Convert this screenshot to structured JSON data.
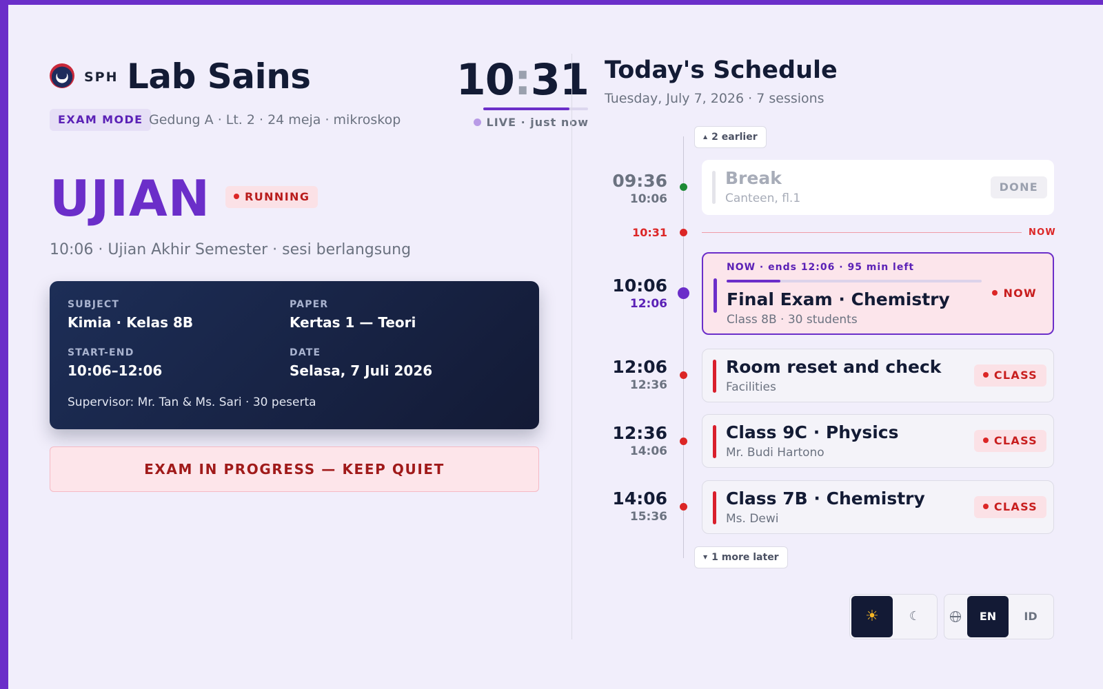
{
  "colors": {
    "accent": "#6b2ec9",
    "danger": "#dc2626",
    "done_green": "#1d8a35",
    "card_dark": "#131a35",
    "background": "#f1eefb"
  },
  "header": {
    "logo_icon": "school-crest-icon",
    "brand": "SPH",
    "room_title": "Lab Sains",
    "mode_badge": "EXAM MODE",
    "room_meta": "Gedung A · Lt. 2 · 24 meja · mikroskop"
  },
  "clock": {
    "hours": "10",
    "separator": ":",
    "minutes": "31",
    "progress_fraction": 0.82,
    "live_label": "LIVE · just now"
  },
  "status": {
    "title": "UJIAN",
    "badge": "RUNNING",
    "subtitle": "10:06 · Ujian Akhir Semester · sesi berlangsung"
  },
  "detail": {
    "subject_label": "SUBJECT",
    "subject_value": "Kimia · Kelas 8B",
    "paper_label": "PAPER",
    "paper_value": "Kertas 1 — Teori",
    "time_label": "START-END",
    "time_value": "10:06–12:06",
    "date_label": "DATE",
    "date_value": "Selasa, 7 Juli 2026",
    "supervisor": "Supervisor: Mr. Tan & Ms. Sari · 30 peserta"
  },
  "banner": "EXAM IN PROGRESS — KEEP QUIET",
  "schedule": {
    "title": "Today's Schedule",
    "subtitle": "Tuesday, July 7, 2026 · 7 sessions",
    "earlier_label": "2 earlier",
    "later_label": "1 more later",
    "now_time": "10:31",
    "now_marker": "NOW",
    "items": [
      {
        "start": "09:36",
        "end": "10:06",
        "title": "Break",
        "sub": "Canteen, fl.1",
        "tag": "DONE",
        "state": "done"
      },
      {
        "start": "10:06",
        "end": "12:06",
        "title": "Final Exam · Chemistry",
        "sub": "Class 8B · 30 students",
        "tag": "NOW",
        "state": "now",
        "now_header": "NOW · ends 12:06 · 95 min left",
        "progress_fraction": 0.21
      },
      {
        "start": "12:06",
        "end": "12:36",
        "title": "Room reset and check",
        "sub": "Facilities",
        "tag": "CLASS",
        "state": "upcoming"
      },
      {
        "start": "12:36",
        "end": "14:06",
        "title": "Class 9C · Physics",
        "sub": "Mr. Budi Hartono",
        "tag": "CLASS",
        "state": "upcoming"
      },
      {
        "start": "14:06",
        "end": "15:36",
        "title": "Class 7B · Chemistry",
        "sub": "Ms. Dewi",
        "tag": "CLASS",
        "state": "upcoming"
      }
    ]
  },
  "controls": {
    "theme_light_icon": "sun-icon",
    "theme_dark_icon": "moon-icon",
    "theme_light_glyph": "☀",
    "theme_dark_glyph": "☾",
    "language_icon": "globe-icon",
    "lang_en": "EN",
    "lang_id": "ID"
  }
}
